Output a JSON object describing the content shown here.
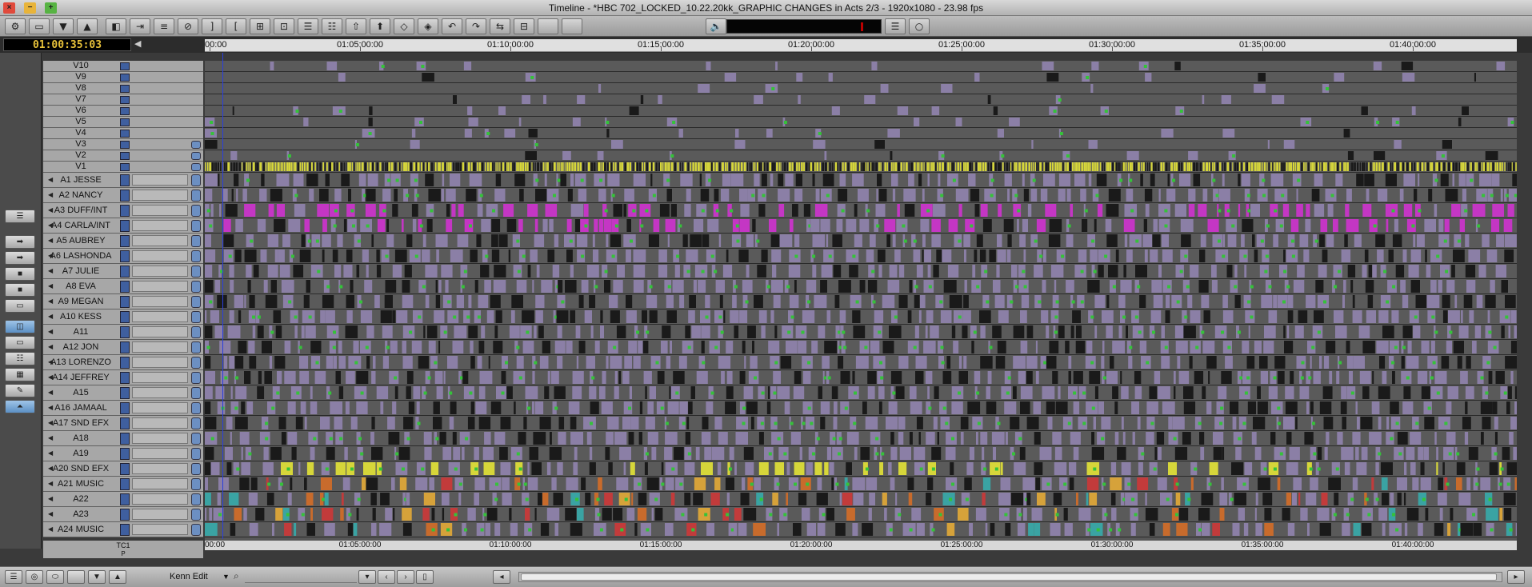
{
  "window": {
    "title": "Timeline - *HBC 702_LOCKED_10.22.20kk_GRAPHIC CHANGES in Acts 2/3 - 1920x1080 - 23.98 fps"
  },
  "timecode": {
    "current": "01:00:35:03"
  },
  "ruler": {
    "labels": [
      "00:00",
      "01:05:00:00",
      "01:10:00:00",
      "01:15:00:00",
      "01:20:00:00",
      "01:25:00:00",
      "01:30:00:00",
      "01:35:00:00",
      "01:40:00:00"
    ],
    "bottom_labels": [
      "00:00",
      "01:05:00:00",
      "01:10:00:00",
      "01:15:00:00",
      "01:20:00:00",
      "01:25:00:00",
      "01:30:00:00",
      "01:35:00:00",
      "01:40:00:00"
    ]
  },
  "tracks": {
    "video": [
      "V10",
      "V9",
      "V8",
      "V7",
      "V6",
      "V5",
      "V4",
      "V3",
      "V2",
      "V1"
    ],
    "audio": [
      "A1 JESSE",
      "A2 NANCY",
      "A3 DUFF/INT",
      "A4 CARLA/INT",
      "A5 AUBREY",
      "A6 LASHONDA",
      "A7 JULIE",
      "A8 EVA",
      "A9 MEGAN",
      "A10 KESS",
      "A11",
      "A12 JON",
      "A13 LORENZO",
      "A14 JEFFREY",
      "A15",
      "A16 JAMAAL",
      "A17 SND EFX",
      "A18",
      "A19",
      "A20 SND EFX",
      "A21 MUSIC",
      "A22",
      "A23",
      "A24 MUSIC"
    ]
  },
  "footer": {
    "tc_track": "TC1",
    "p_track": "P",
    "workspace": "Kenn Edit"
  },
  "colors": {
    "clip_fill": "#8b7fa6",
    "clip_video_yellow": "#d6d63a",
    "clip_magenta": "#c436c4",
    "effect_green": "#35c23a",
    "playhead": "#2a3fdb",
    "timecode_text": "#e8c23a"
  },
  "icons": {
    "close": "×",
    "minimize": "−",
    "maximize": "+"
  }
}
